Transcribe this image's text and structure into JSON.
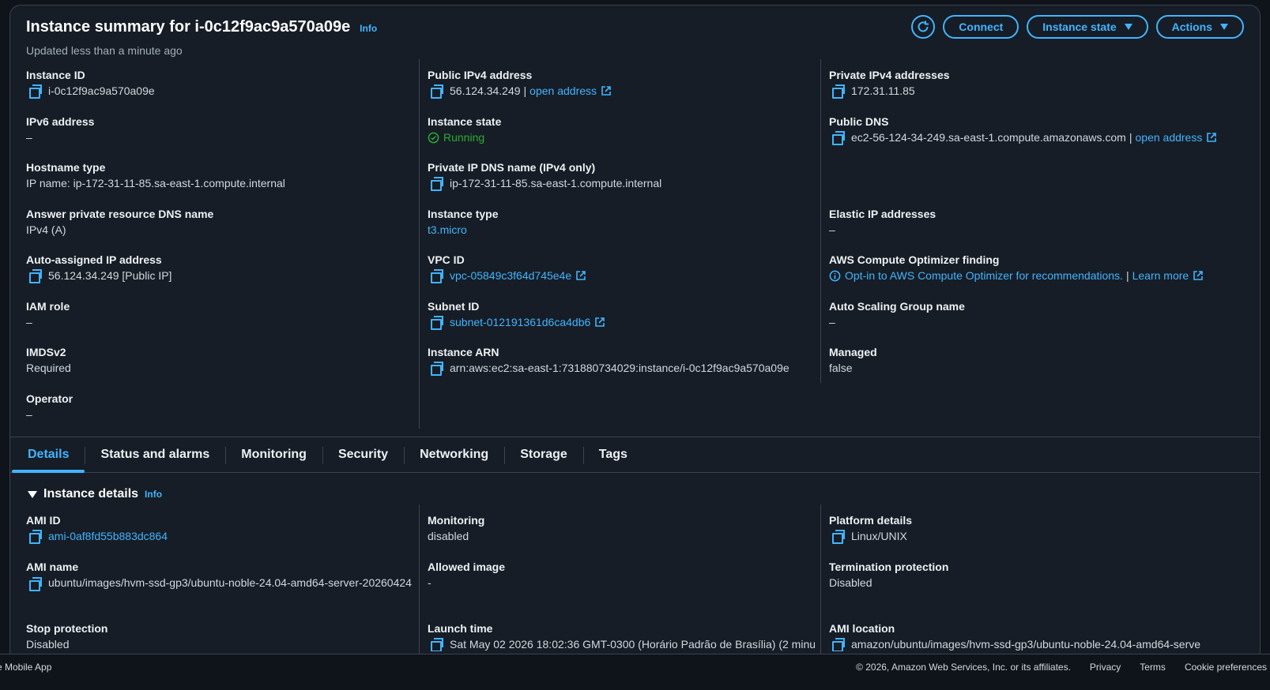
{
  "header": {
    "title": "Instance summary for i-0c12f9ac9a570a09e",
    "info": "Info",
    "updated": "Updated less than a minute ago"
  },
  "actions": {
    "connect": "Connect",
    "instance_state": "Instance state",
    "actions": "Actions"
  },
  "summary": {
    "instance_id": {
      "label": "Instance ID",
      "value": "i-0c12f9ac9a570a09e"
    },
    "ipv6": {
      "label": "IPv6 address",
      "value": "–"
    },
    "hostname_type": {
      "label": "Hostname type",
      "value": "IP name: ip-172-31-11-85.sa-east-1.compute.internal"
    },
    "answer_dns": {
      "label": "Answer private resource DNS name",
      "value": "IPv4 (A)"
    },
    "auto_ip": {
      "label": "Auto-assigned IP address",
      "value": "56.124.34.249 [Public IP]"
    },
    "iam_role": {
      "label": "IAM role",
      "value": "–"
    },
    "imdsv2": {
      "label": "IMDSv2",
      "value": "Required"
    },
    "operator": {
      "label": "Operator",
      "value": "–"
    },
    "public_ipv4": {
      "label": "Public IPv4 address",
      "value": "56.124.34.249",
      "sep": "|",
      "link": "open address"
    },
    "instance_state": {
      "label": "Instance state",
      "value": "Running"
    },
    "private_ip_dns": {
      "label": "Private IP DNS name (IPv4 only)",
      "value": "ip-172-31-11-85.sa-east-1.compute.internal"
    },
    "instance_type": {
      "label": "Instance type",
      "value": "t3.micro"
    },
    "vpc_id": {
      "label": "VPC ID",
      "value": "vpc-05849c3f64d745e4e"
    },
    "subnet_id": {
      "label": "Subnet ID",
      "value": "subnet-012191361d6ca4db6"
    },
    "instance_arn": {
      "label": "Instance ARN",
      "value": "arn:aws:ec2:sa-east-1:731880734029:instance/i-0c12f9ac9a570a09e"
    },
    "private_ipv4": {
      "label": "Private IPv4 addresses",
      "value": "172.31.11.85"
    },
    "public_dns": {
      "label": "Public DNS",
      "value": "ec2-56-124-34-249.sa-east-1.compute.amazonaws.com",
      "sep": "|",
      "link": "open address"
    },
    "elastic_ip": {
      "label": "Elastic IP addresses",
      "value": "–"
    },
    "optimizer": {
      "label": "AWS Compute Optimizer finding",
      "value": "Opt-in to AWS Compute Optimizer for recommendations.",
      "sep": "|",
      "link": "Learn more"
    },
    "asg": {
      "label": "Auto Scaling Group name",
      "value": "–"
    },
    "managed": {
      "label": "Managed",
      "value": "false"
    }
  },
  "tabs": [
    "Details",
    "Status and alarms",
    "Monitoring",
    "Security",
    "Networking",
    "Storage",
    "Tags"
  ],
  "details": {
    "title": "Instance details",
    "info": "Info",
    "ami_id": {
      "label": "AMI ID",
      "value": "ami-0af8fd55b883dc864"
    },
    "ami_name": {
      "label": "AMI name",
      "value": "ubuntu/images/hvm-ssd-gp3/ubuntu-noble-24.04-amd64-server-20260424"
    },
    "stop_protection": {
      "label": "Stop protection",
      "value": "Disabled"
    },
    "monitoring": {
      "label": "Monitoring",
      "value": "disabled"
    },
    "allowed_image": {
      "label": "Allowed image",
      "value": "-"
    },
    "launch_time": {
      "label": "Launch time",
      "value": "Sat May 02 2026 18:02:36 GMT-0300 (Horário Padrão de Brasília) (2 minu"
    },
    "platform": {
      "label": "Platform details",
      "value": "Linux/UNIX"
    },
    "termination": {
      "label": "Termination protection",
      "value": "Disabled"
    },
    "ami_location": {
      "label": "AMI location",
      "value": "amazon/ubuntu/images/hvm-ssd-gp3/ubuntu-noble-24.04-amd64-serve"
    }
  },
  "footer": {
    "left": "e Mobile App",
    "copyright": "© 2026, Amazon Web Services, Inc. or its affiliates.",
    "privacy": "Privacy",
    "terms": "Terms",
    "cookies": "Cookie preferences"
  },
  "colors": {
    "accent": "#42b4ff",
    "running": "#29ad32",
    "background": "#161d26"
  }
}
